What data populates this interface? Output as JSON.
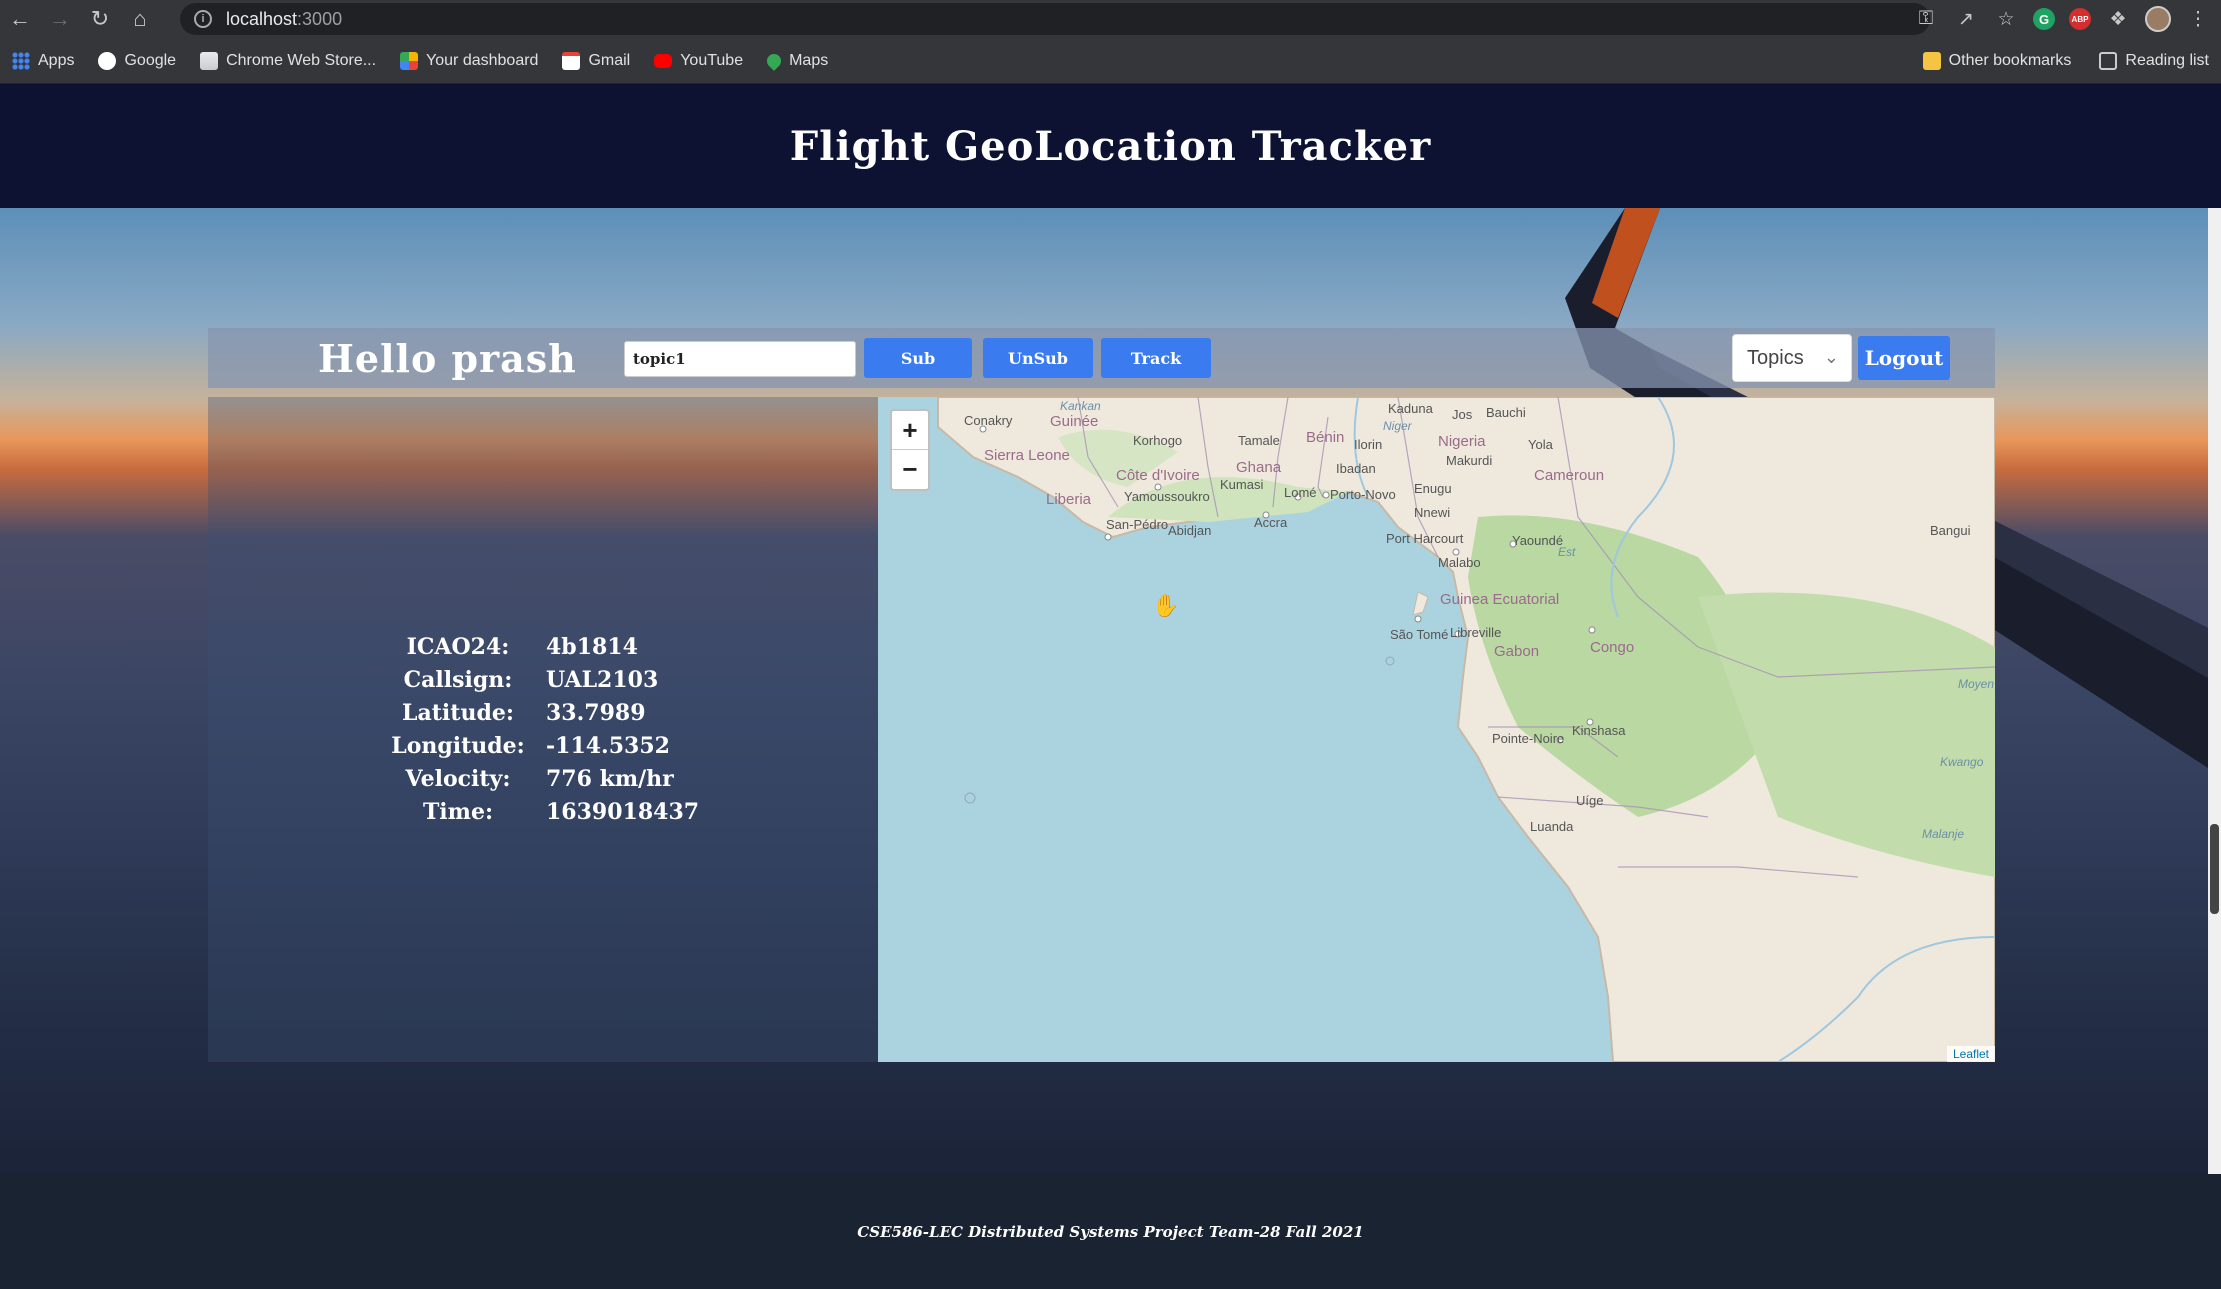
{
  "browser": {
    "url_host": "localhost",
    "url_port": ":3000",
    "bookmarks": [
      {
        "label": "Apps",
        "icon": "apps-grid-icon",
        "color": "#4285f4"
      },
      {
        "label": "Google",
        "icon": "google-icon",
        "color": "#ffffff"
      },
      {
        "label": "Chrome Web Store...",
        "icon": "chrome-web-store-icon",
        "color": "#e8eaed"
      },
      {
        "label": "Your dashboard",
        "icon": "dashboard-icon",
        "color": "#f4b400"
      },
      {
        "label": "Gmail",
        "icon": "gmail-icon",
        "color": "#ea4335"
      },
      {
        "label": "YouTube",
        "icon": "youtube-icon",
        "color": "#ff0000"
      },
      {
        "label": "Maps",
        "icon": "maps-icon",
        "color": "#34a853"
      }
    ],
    "other_bookmarks": "Other bookmarks",
    "reading_list": "Reading list"
  },
  "app": {
    "title": "Flight GeoLocation Tracker",
    "greeting": "Hello prash",
    "topic_value": "topic1",
    "buttons": {
      "sub": "Sub",
      "unsub": "UnSub",
      "track": "Track",
      "logout": "Logout"
    },
    "topics_dropdown": "Topics",
    "colors": {
      "header_bg": "#0d1233",
      "button_blue": "#3a7cf0",
      "footer_bg": "#1a2331"
    }
  },
  "flight": {
    "rows": [
      {
        "label": "ICAO24:",
        "value": "4b1814"
      },
      {
        "label": "Callsign:",
        "value": "UAL2103"
      },
      {
        "label": "Latitude:",
        "value": "33.7989"
      },
      {
        "label": "Longitude:",
        "value": "-114.5352"
      },
      {
        "label": "Velocity:",
        "value": "776 km/hr"
      },
      {
        "label": "Time:",
        "value": "1639018437"
      }
    ]
  },
  "map": {
    "zoom_in": "+",
    "zoom_out": "−",
    "attribution": "Leaflet",
    "labels": {
      "conakry": "Conakry",
      "guinee": "Guinée",
      "kankan": "Kankan",
      "sierra_leone": "Sierra Leone",
      "korhogo": "Korhogo",
      "tamale": "Tamale",
      "benin": "Bénin",
      "kaduna": "Kaduna",
      "jos": "Jos",
      "bauchi": "Bauchi",
      "niger": "Niger",
      "nigeria": "Nigeria",
      "ilorin": "Ilorin",
      "yola": "Yola",
      "ghana": "Ghana",
      "makurdi": "Makurdi",
      "cote_divoire": "Côte d'Ivoire",
      "ibadan": "Ibadan",
      "kumasi": "Kumasi",
      "cameroun": "Cameroun",
      "yamoussoukro": "Yamoussoukro",
      "liberia": "Liberia",
      "lome": "Lomé",
      "porto_novo": "Porto-Novo",
      "enugu": "Enugu",
      "san_pedro": "San-Pédro",
      "abidjan": "Abidjan",
      "accra": "Accra",
      "nnewi": "Nnewi",
      "port_harcourt": "Port Harcourt",
      "yaounde": "Yaoundé",
      "bangui": "Bangui",
      "est": "Est",
      "malabo": "Malabo",
      "guinea_ecuatorial": "Guinea Ecuatorial",
      "sao_tome": "São Tomé",
      "libreville": "Libreville",
      "gabon": "Gabon",
      "congo": "Congo",
      "moyen": "Moyen",
      "pointe_noire": "Pointe-Noire",
      "kinshasa": "Kinshasa",
      "kwango": "Kwango",
      "uige": "Uíge",
      "luanda": "Luanda",
      "malanje": "Malanje"
    }
  },
  "footer": {
    "text": "CSE586-LEC Distributed Systems Project Team-28 Fall 2021"
  }
}
